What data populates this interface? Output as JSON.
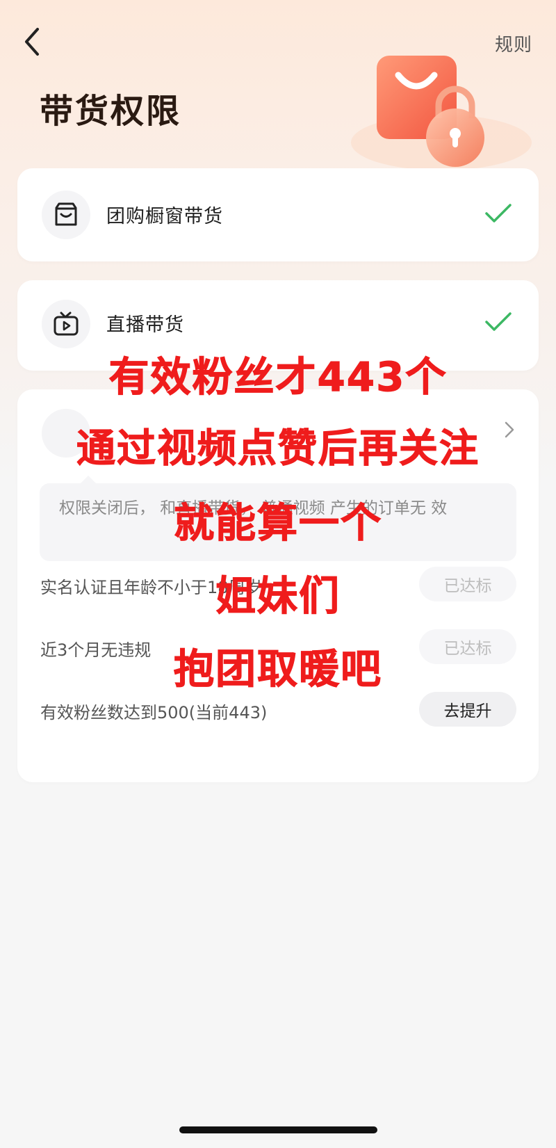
{
  "header": {
    "title": "带货权限",
    "rules_label": "规则"
  },
  "permissions": [
    {
      "label": "团购橱窗带货",
      "icon": "storefront-icon",
      "status": "enabled"
    },
    {
      "label": "直播带货",
      "icon": "tv-play-icon",
      "status": "enabled"
    }
  ],
  "video_permission": {
    "note": "权限关闭后， 和直播带货， 普通视频 产生的订单无 效"
  },
  "requirements": [
    {
      "label": "实名认证且年龄不小于18周岁",
      "button": "已达标",
      "state": "done"
    },
    {
      "label": "近3个月无违规",
      "button": "已达标",
      "state": "done"
    },
    {
      "label": "有效粉丝数达到500(当前443)",
      "button": "去提升",
      "state": "todo"
    }
  ],
  "overlay_caption": {
    "line1": "有效粉丝才443个",
    "line2": "通过视频点赞后再关注",
    "line3": "就能算一个",
    "line4": "姐妹们",
    "line5": "抱团取暖吧"
  },
  "colors": {
    "accent_green": "#3cb863",
    "overlay_red": "#ef1c1c",
    "hero_orange": "#f76a4a"
  }
}
